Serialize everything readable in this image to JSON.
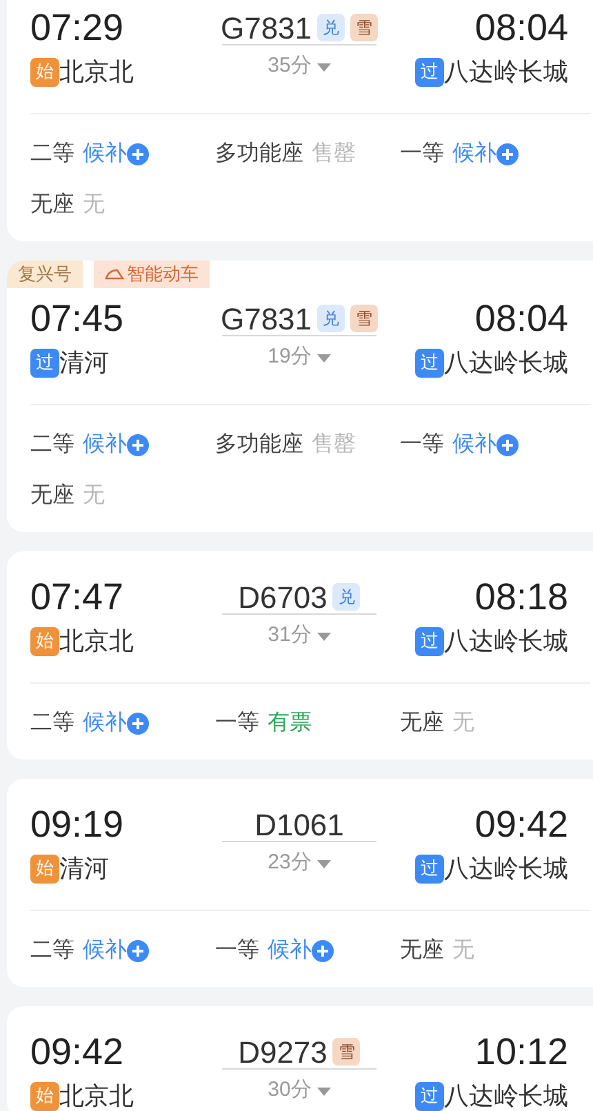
{
  "trains": [
    {
      "depart_time": "07:29",
      "depart_badge": {
        "text": "始",
        "kind": "origin"
      },
      "depart_station": "北京北",
      "train_no": "G7831",
      "train_badges": [
        {
          "text": "兑",
          "kind": "exchange"
        },
        {
          "text": "雪",
          "kind": "snow"
        }
      ],
      "duration": "35分",
      "arrive_time": "08:04",
      "arrive_badge": {
        "text": "过",
        "kind": "pass"
      },
      "arrive_station": "八达岭长城",
      "seat_rows": [
        [
          {
            "class": "二等",
            "status": "候补",
            "kind": "waitlist"
          },
          {
            "class": "多功能座",
            "status": "售罄",
            "kind": "soldout"
          },
          {
            "class": "一等",
            "status": "候补",
            "kind": "waitlist"
          }
        ],
        [
          {
            "class": "无座",
            "status": "无",
            "kind": "soldout"
          }
        ]
      ]
    },
    {
      "tags": [
        {
          "text": "复兴号",
          "kind": "fuxing"
        },
        {
          "text": "智能动车",
          "kind": "smart"
        }
      ],
      "depart_time": "07:45",
      "depart_badge": {
        "text": "过",
        "kind": "pass"
      },
      "depart_station": "清河",
      "train_no": "G7831",
      "train_badges": [
        {
          "text": "兑",
          "kind": "exchange"
        },
        {
          "text": "雪",
          "kind": "snow"
        }
      ],
      "duration": "19分",
      "arrive_time": "08:04",
      "arrive_badge": {
        "text": "过",
        "kind": "pass"
      },
      "arrive_station": "八达岭长城",
      "seat_rows": [
        [
          {
            "class": "二等",
            "status": "候补",
            "kind": "waitlist"
          },
          {
            "class": "多功能座",
            "status": "售罄",
            "kind": "soldout"
          },
          {
            "class": "一等",
            "status": "候补",
            "kind": "waitlist"
          }
        ],
        [
          {
            "class": "无座",
            "status": "无",
            "kind": "soldout"
          }
        ]
      ]
    },
    {
      "depart_time": "07:47",
      "depart_badge": {
        "text": "始",
        "kind": "origin"
      },
      "depart_station": "北京北",
      "train_no": "D6703",
      "train_badges": [
        {
          "text": "兑",
          "kind": "exchange"
        }
      ],
      "duration": "31分",
      "arrive_time": "08:18",
      "arrive_badge": {
        "text": "过",
        "kind": "pass"
      },
      "arrive_station": "八达岭长城",
      "seat_rows": [
        [
          {
            "class": "二等",
            "status": "候补",
            "kind": "waitlist"
          },
          {
            "class": "一等",
            "status": "有票",
            "kind": "available"
          },
          {
            "class": "无座",
            "status": "无",
            "kind": "soldout"
          }
        ]
      ]
    },
    {
      "depart_time": "09:19",
      "depart_badge": {
        "text": "始",
        "kind": "origin"
      },
      "depart_station": "清河",
      "train_no": "D1061",
      "duration": "23分",
      "arrive_time": "09:42",
      "arrive_badge": {
        "text": "过",
        "kind": "pass"
      },
      "arrive_station": "八达岭长城",
      "seat_rows": [
        [
          {
            "class": "二等",
            "status": "候补",
            "kind": "waitlist"
          },
          {
            "class": "一等",
            "status": "候补",
            "kind": "waitlist"
          },
          {
            "class": "无座",
            "status": "无",
            "kind": "soldout"
          }
        ]
      ]
    },
    {
      "depart_time": "09:42",
      "depart_badge": {
        "text": "始",
        "kind": "origin"
      },
      "depart_station": "北京北",
      "train_no": "D9273",
      "train_badges": [
        {
          "text": "雪",
          "kind": "snow"
        }
      ],
      "duration": "30分",
      "arrive_time": "10:12",
      "arrive_badge": {
        "text": "过",
        "kind": "pass"
      },
      "arrive_station": "八达岭长城"
    }
  ]
}
